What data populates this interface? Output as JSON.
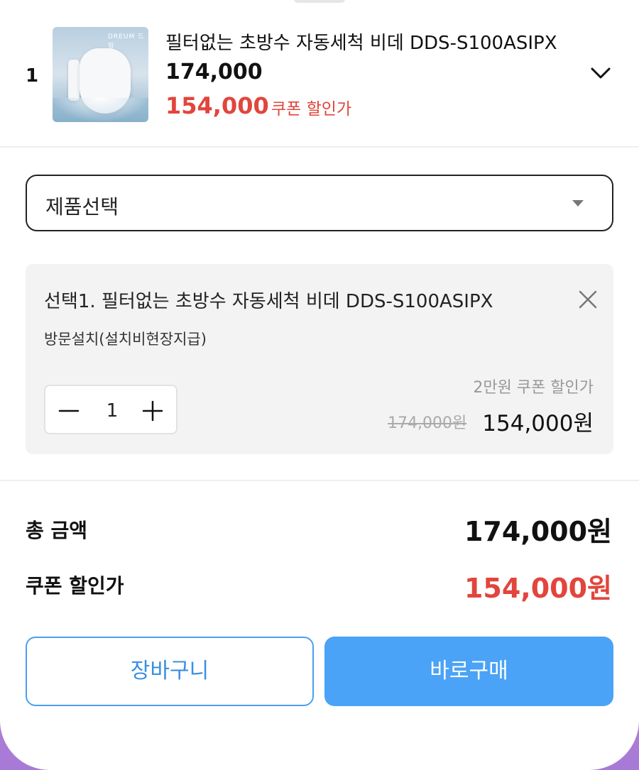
{
  "colors": {
    "sale_red": "#e2453c",
    "accent_blue": "#4aa3f6",
    "text_dark": "#111111",
    "muted_gray": "#999999"
  },
  "product": {
    "index": "1",
    "name": "필터없는 초방수 자동세척 비데 DDS-S100ASIPX",
    "price": "174,000",
    "sale_price": "154,000",
    "sale_label": "쿠폰 할인가",
    "thumbnail_brand": "DREUM 드림",
    "expand_icon": "chevron-down-icon"
  },
  "select": {
    "label": "제품선택",
    "icon": "caret-down-icon"
  },
  "option": {
    "title": "선택1. 필터없는 초방수 자동세척 비데 DDS-S100ASIPX",
    "subtitle": "방문설치(설치비현장지급)",
    "remove_icon": "close-icon",
    "quantity": "1",
    "coupon_note": "2만원 쿠폰 할인가",
    "original_price": "174,000원",
    "final_price": "154,000원"
  },
  "summary": {
    "total_label": "총 금액",
    "total_value": "174,000원",
    "coupon_label": "쿠폰 할인가",
    "coupon_value": "154,000원"
  },
  "actions": {
    "cart_label": "장바구니",
    "buy_label": "바로구매"
  }
}
